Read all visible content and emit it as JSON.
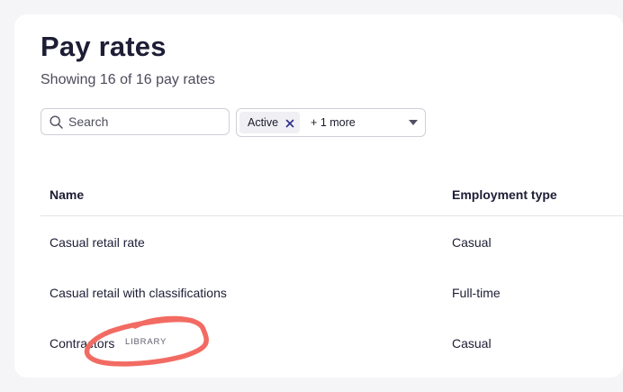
{
  "page": {
    "title": "Pay rates",
    "subtitle": "Showing 16 of 16 pay rates"
  },
  "search": {
    "placeholder": "Search",
    "icon": "search-icon"
  },
  "filter": {
    "chip_label": "Active",
    "more_label": "+ 1 more",
    "accent": "#2f2f8f"
  },
  "table": {
    "columns": [
      "Name",
      "Employment type"
    ],
    "rows": [
      {
        "name": "Casual retail rate",
        "type": "Casual",
        "badge": ""
      },
      {
        "name": "Casual retail with classifications",
        "type": "Full-time",
        "badge": ""
      },
      {
        "name": "Contractors",
        "type": "Casual",
        "badge": "LIBRARY"
      }
    ]
  },
  "annotation": {
    "color": "#f26b63"
  }
}
